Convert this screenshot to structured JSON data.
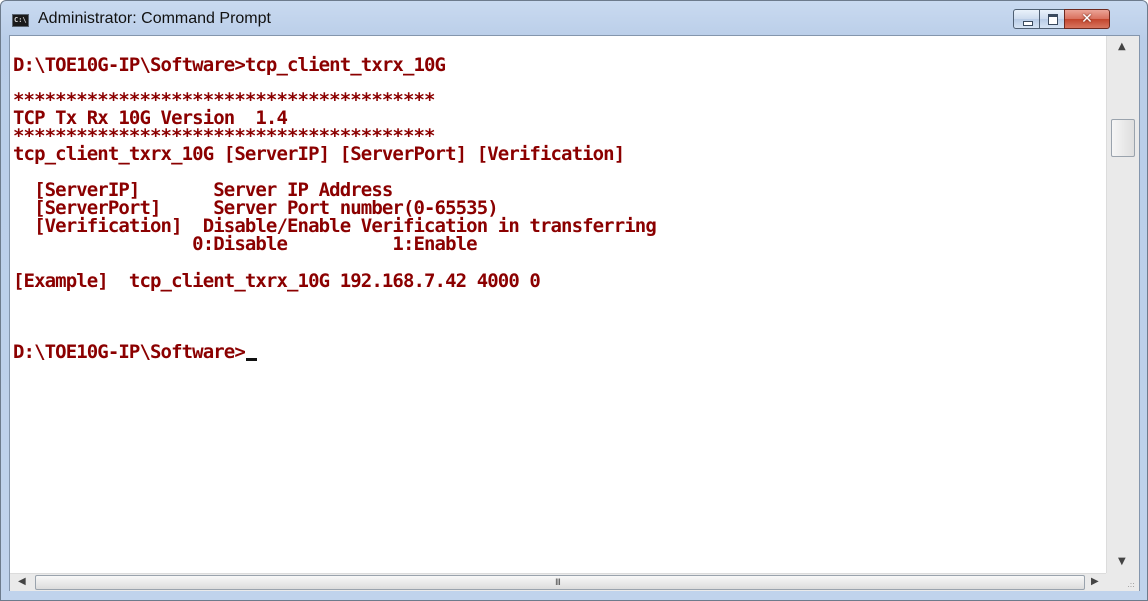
{
  "window": {
    "title": "Administrator: Command Prompt",
    "icon": "cmd-icon",
    "icon_text": "C:\\",
    "controls": {
      "minimize": "minimize-icon",
      "maximize": "maximize-icon",
      "close": "close-icon",
      "close_glyph": "✕"
    }
  },
  "console": {
    "text_color": "#8b0000",
    "background": "#ffffff",
    "lines": [
      "D:\\TOE10G-IP\\Software>tcp_client_txrx_10G",
      "****************************************",
      "TCP Tx Rx 10G Version  1.4",
      "****************************************",
      "tcp_client_txrx_10G [ServerIP] [ServerPort] [Verification]",
      "  [ServerIP]       Server IP Address",
      "  [ServerPort]     Server Port number(0-65535)",
      "  [Verification]  Disable/Enable Verification in transferring",
      "                 0:Disable          1:Enable",
      "[Example]  tcp_client_txrx_10G 192.168.7.42 4000 0",
      "D:\\TOE10G-IP\\Software>"
    ]
  },
  "scrollbars": {
    "up_arrow": "▲",
    "down_arrow": "▼",
    "left_arrow": "◀",
    "right_arrow": "▶",
    "grip": "III",
    "size_grip": ".::"
  }
}
